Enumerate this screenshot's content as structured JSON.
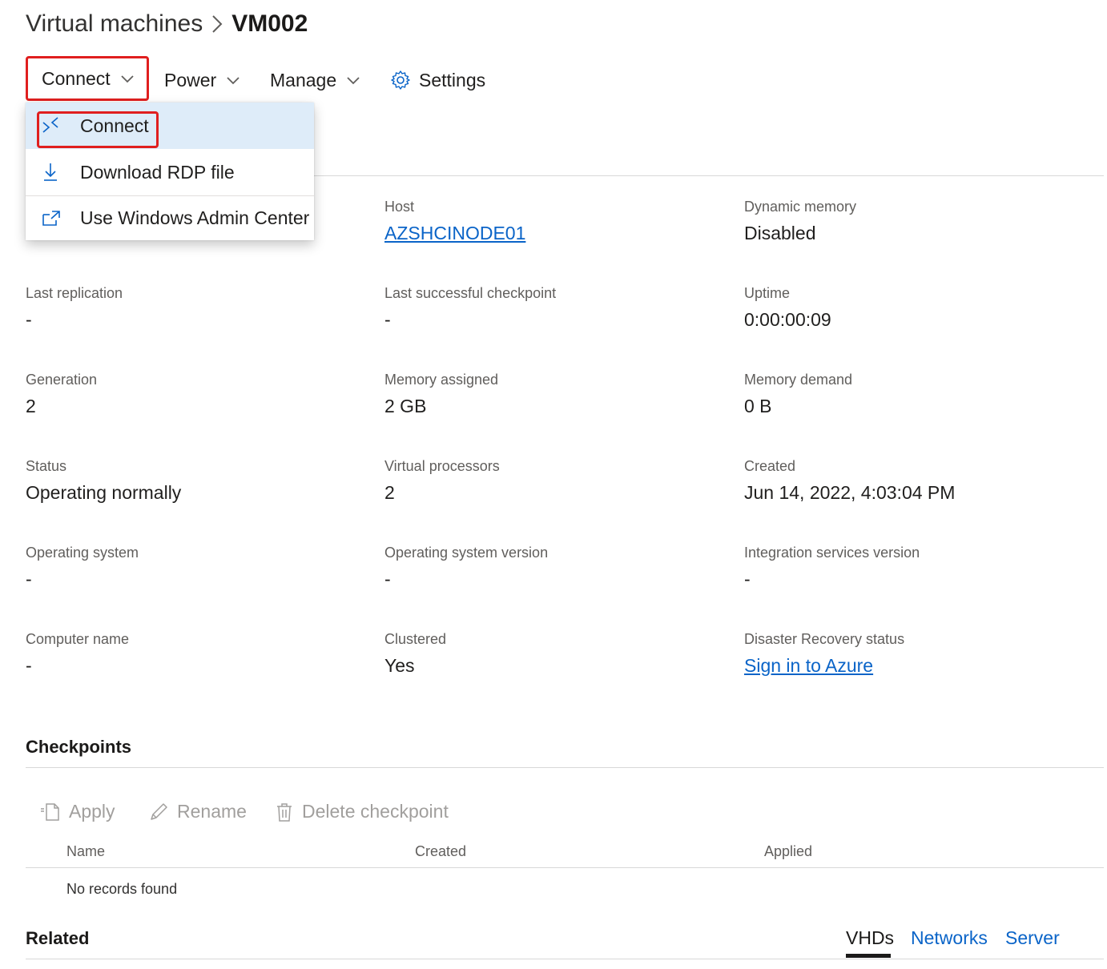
{
  "breadcrumb": {
    "parent": "Virtual machines",
    "current": "VM002"
  },
  "toolbar": {
    "connect": "Connect",
    "power": "Power",
    "manage": "Manage",
    "settings": "Settings"
  },
  "connect_menu": {
    "items": [
      {
        "label": "Connect",
        "icon": "remote-connect-icon"
      },
      {
        "label": "Download RDP file",
        "icon": "download-icon"
      },
      {
        "label": "Use Windows Admin Center",
        "icon": "open-external-icon"
      }
    ]
  },
  "properties": [
    {
      "label": "Host",
      "value": "AZSHCINODE01",
      "link": true
    },
    {
      "label": "Dynamic memory",
      "value": "Disabled"
    },
    {
      "label": "Last replication",
      "value": "-"
    },
    {
      "label": "Last successful checkpoint",
      "value": "-"
    },
    {
      "label": "Uptime",
      "value": "0:00:00:09"
    },
    {
      "label": "Generation",
      "value": "2"
    },
    {
      "label": "Memory assigned",
      "value": "2 GB"
    },
    {
      "label": "Memory demand",
      "value": "0 B"
    },
    {
      "label": "Status",
      "value": "Operating normally"
    },
    {
      "label": "Virtual processors",
      "value": "2"
    },
    {
      "label": "Created",
      "value": "Jun 14, 2022, 4:03:04 PM"
    },
    {
      "label": "Operating system",
      "value": "-"
    },
    {
      "label": "Operating system version",
      "value": "-"
    },
    {
      "label": "Integration services version",
      "value": "-"
    },
    {
      "label": "Computer name",
      "value": "-"
    },
    {
      "label": "Clustered",
      "value": "Yes"
    },
    {
      "label": "Disaster Recovery status",
      "value": "Sign in to Azure",
      "link": true
    }
  ],
  "checkpoints": {
    "title": "Checkpoints",
    "actions": {
      "apply": "Apply",
      "rename": "Rename",
      "delete": "Delete checkpoint"
    },
    "columns": [
      "Name",
      "Created",
      "Applied"
    ],
    "empty_text": "No records found"
  },
  "related": {
    "title": "Related",
    "tabs": [
      {
        "label": "VHDs",
        "active": true
      },
      {
        "label": "Networks",
        "active": false
      },
      {
        "label": "Server",
        "active": false
      }
    ]
  },
  "colors": {
    "accent": "#0a64c8",
    "highlight_outline": "#e01f1f",
    "menu_hover": "#deecf9",
    "disabled_text": "#a19f9d"
  }
}
